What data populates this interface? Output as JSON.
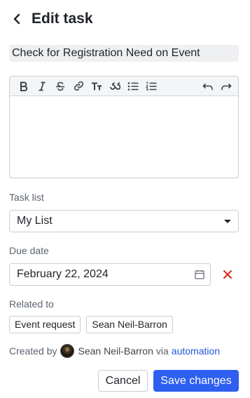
{
  "header": {
    "title": "Edit task",
    "back_icon": "chevron-left-icon"
  },
  "task": {
    "name": "Check for Registration Need on Event"
  },
  "editor": {
    "toolbar": [
      "bold-icon",
      "italic-icon",
      "strikethrough-icon",
      "link-icon",
      "text-size-icon",
      "quote-icon",
      "bullet-list-icon",
      "numbered-list-icon",
      "undo-icon",
      "redo-icon"
    ],
    "body": ""
  },
  "task_list": {
    "label": "Task list",
    "value": "My List"
  },
  "due_date": {
    "label": "Due date",
    "value": "February 22, 2024",
    "clear_color": "#d93025"
  },
  "related": {
    "label": "Related to",
    "chips": [
      "Event request",
      "Sean Neil-Barron"
    ]
  },
  "created": {
    "prefix": "Created by",
    "author": "Sean Neil-Barron",
    "via": "via",
    "source": "automation"
  },
  "actions": {
    "cancel": "Cancel",
    "save": "Save changes"
  },
  "colors": {
    "primary": "#2e5ff0",
    "link": "#2456d8",
    "danger": "#d93025"
  }
}
